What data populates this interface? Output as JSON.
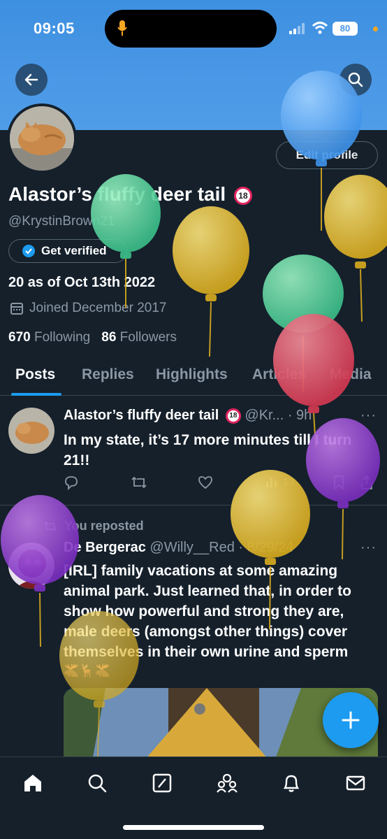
{
  "status_bar": {
    "time": "09:05",
    "battery": "80"
  },
  "profile": {
    "display_name": "Alastor’s fluffy deer tail",
    "age_badge": "18",
    "handle": "@KrystinBrown21",
    "edit_profile_label": "Edit profile",
    "get_verified_label": "Get verified",
    "bio": "20 as of Oct 13th 2022",
    "joined": "Joined December 2017",
    "following_count": "670",
    "following_label": "Following",
    "followers_count": "86",
    "followers_label": "Followers"
  },
  "tabs": [
    {
      "label": "Posts",
      "active": true
    },
    {
      "label": "Replies"
    },
    {
      "label": "Highlights"
    },
    {
      "label": "Articles"
    },
    {
      "label": "Media"
    }
  ],
  "posts": [
    {
      "author": "Alastor’s fluffy deer tail",
      "badge": "18",
      "handle_time": "@Kr... · 9h",
      "text": "In my state, it’s 17 more minutes till I turn 21!!",
      "views": "13"
    },
    {
      "reposted_label": "You reposted",
      "author": "De Bergerac",
      "handle_time": "@Willy__Red · 8/29/24",
      "text": "[IRL] family vacations at some amazing animal park. Just learned that, in order to show how powerful and strong they are, male deers (amongst other things) cover themselves in their own urine and sperm",
      "emojis": "🫎🦌🫎"
    }
  ],
  "icons": {
    "back": "arrow-left-icon",
    "search": "search-icon",
    "verified": "verified-badge-icon",
    "calendar": "calendar-icon",
    "reply": "reply-icon",
    "repost": "repost-icon",
    "like": "heart-icon",
    "views": "views-icon",
    "bookmark": "bookmark-icon",
    "share": "share-icon",
    "compose": "plus-icon",
    "home": "home-icon",
    "explore": "search-icon",
    "grok": "grok-icon",
    "communities": "communities-icon",
    "notifications": "bell-icon",
    "messages": "mail-icon"
  },
  "colors": {
    "accent": "#1d9bf0",
    "background": "#15202b",
    "banner": "#4a98e6"
  }
}
